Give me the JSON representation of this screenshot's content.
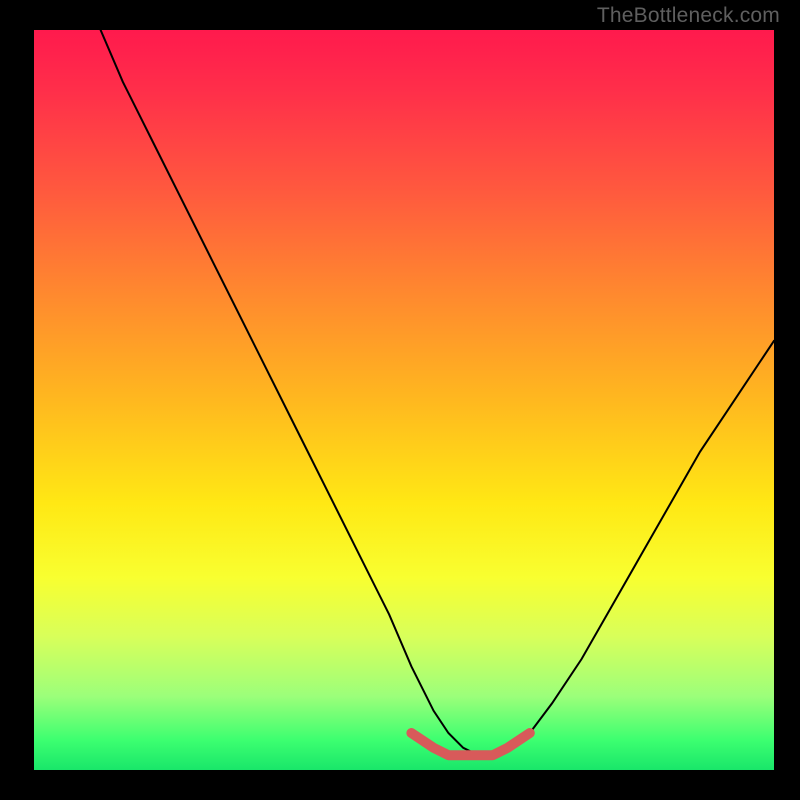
{
  "watermark": "TheBottleneck.com",
  "chart_data": {
    "type": "line",
    "title": "",
    "xlabel": "",
    "ylabel": "",
    "xlim": [
      0,
      100
    ],
    "ylim": [
      0,
      100
    ],
    "series": [
      {
        "name": "bottleneck-curve",
        "x": [
          9,
          12,
          16,
          20,
          24,
          28,
          32,
          36,
          40,
          44,
          48,
          51,
          54,
          56,
          58,
          60,
          62,
          64,
          67,
          70,
          74,
          78,
          82,
          86,
          90,
          94,
          98,
          100
        ],
        "values": [
          100,
          93,
          85,
          77,
          69,
          61,
          53,
          45,
          37,
          29,
          21,
          14,
          8,
          5,
          3,
          2,
          2,
          3,
          5,
          9,
          15,
          22,
          29,
          36,
          43,
          49,
          55,
          58
        ]
      },
      {
        "name": "optimal-zone",
        "x": [
          51,
          54,
          56,
          58,
          60,
          62,
          64,
          67
        ],
        "values": [
          5,
          3,
          2,
          2,
          2,
          2,
          3,
          5
        ]
      }
    ],
    "gradient_stops": [
      {
        "pos": 0,
        "color": "#ff1a4d"
      },
      {
        "pos": 22,
        "color": "#ff5a3e"
      },
      {
        "pos": 50,
        "color": "#ffb81f"
      },
      {
        "pos": 74,
        "color": "#f8ff30"
      },
      {
        "pos": 90,
        "color": "#9cff7a"
      },
      {
        "pos": 100,
        "color": "#19e66a"
      }
    ]
  }
}
